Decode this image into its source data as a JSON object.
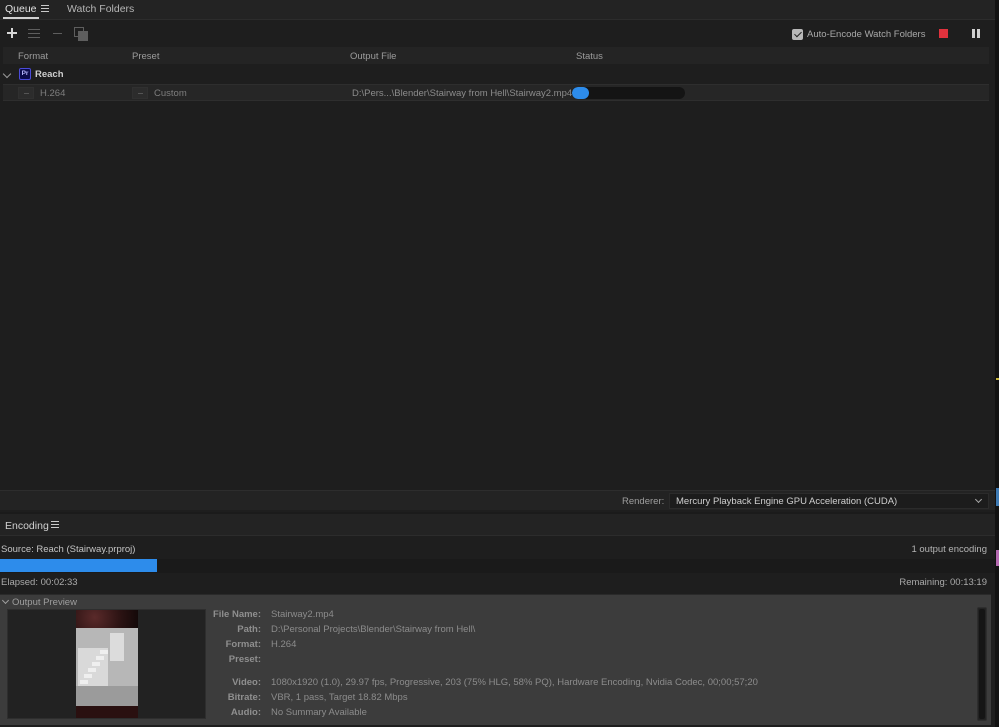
{
  "queue": {
    "tabs": [
      {
        "label": "Queue"
      },
      {
        "label": "Watch Folders"
      }
    ],
    "auto_encode_label": "Auto-Encode Watch Folders",
    "auto_encode_checked": true,
    "columns": [
      "Format",
      "Preset",
      "Output File",
      "Status"
    ],
    "group": {
      "name": "Reach",
      "icon_text": "Pr"
    },
    "items": [
      {
        "format": "H.264",
        "preset": "Custom",
        "output_file": "D:\\Pers...\\Blender\\Stairway from Hell\\Stairway2.mp4",
        "progress": 0.15
      }
    ],
    "renderer_label": "Renderer:",
    "renderer_value": "Mercury Playback Engine GPU Acceleration (CUDA)"
  },
  "encoding": {
    "tab_label": "Encoding",
    "source": "Source: Reach (Stairway.prproj)",
    "output_count": "1 output encoding",
    "progress": 0.158,
    "elapsed": "Elapsed: 00:02:33",
    "remaining": "Remaining: 00:13:19",
    "output_preview_title": "Output Preview",
    "details": {
      "file_name_label": "File Name:",
      "file_name": "Stairway2.mp4",
      "path_label": "Path:",
      "path": "D:\\Personal Projects\\Blender\\Stairway from Hell\\",
      "format_label": "Format:",
      "format": "H.264",
      "preset_label": "Preset:",
      "preset": "",
      "video_label": "Video:",
      "video": "1080x1920 (1.0), 29.97 fps, Progressive, 203 (75% HLG, 58% PQ), Hardware Encoding, Nvidia Codec, 00;00;57;20",
      "bitrate_label": "Bitrate:",
      "bitrate": "VBR, 1 pass, Target 18.82 Mbps",
      "audio_label": "Audio:",
      "audio": "No Summary Available"
    }
  },
  "colors": {
    "accent": "#2d8ceb",
    "stop": "#e0323d",
    "panel": "#1e1e1e",
    "preview_bg": "#3c3c3c"
  }
}
